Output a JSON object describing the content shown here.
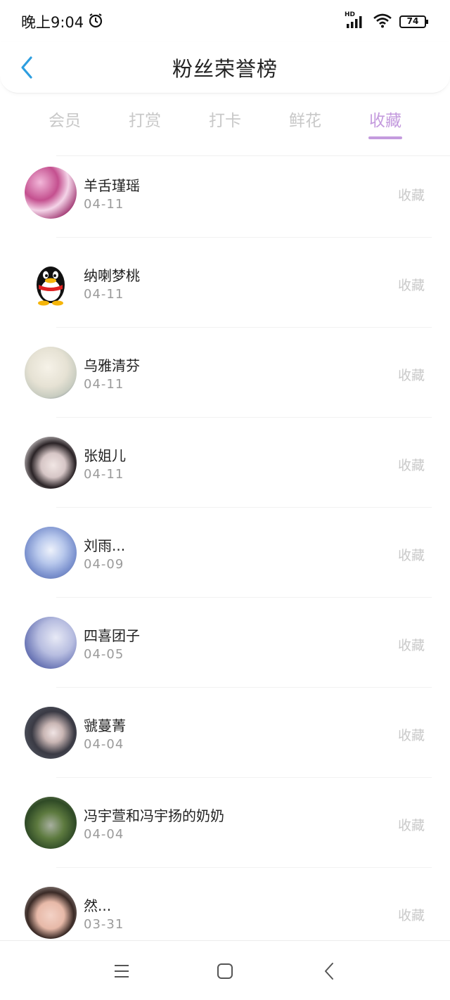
{
  "status": {
    "time": "晚上9:04",
    "battery": "74",
    "network": "HD"
  },
  "header": {
    "title": "粉丝荣誉榜"
  },
  "tabs": [
    {
      "label": "会员",
      "active": false
    },
    {
      "label": "打赏",
      "active": false
    },
    {
      "label": "打卡",
      "active": false
    },
    {
      "label": "鲜花",
      "active": false
    },
    {
      "label": "收藏",
      "active": true
    }
  ],
  "fans": [
    {
      "name": "羊舌瑾瑶",
      "date": "04-11",
      "action": "收藏"
    },
    {
      "name": "纳喇梦桃",
      "date": "04-11",
      "action": "收藏"
    },
    {
      "name": "乌雅清芬",
      "date": "04-11",
      "action": "收藏"
    },
    {
      "name": "张姐儿",
      "date": "04-11",
      "action": "收藏"
    },
    {
      "name": "刘雨...",
      "date": "04-09",
      "action": "收藏"
    },
    {
      "name": "四喜团子",
      "date": "04-05",
      "action": "收藏"
    },
    {
      "name": "虢蔓菁",
      "date": "04-04",
      "action": "收藏"
    },
    {
      "name": "冯宇萱和冯宇扬的奶奶",
      "date": "04-04",
      "action": "收藏"
    },
    {
      "name": "然...",
      "date": "03-31",
      "action": "收藏"
    }
  ],
  "colors": {
    "accent": "#c49bde",
    "back_arrow": "#2d9ee0",
    "inactive_tab": "#c8c8c8",
    "secondary_text": "#9b9b9b"
  }
}
